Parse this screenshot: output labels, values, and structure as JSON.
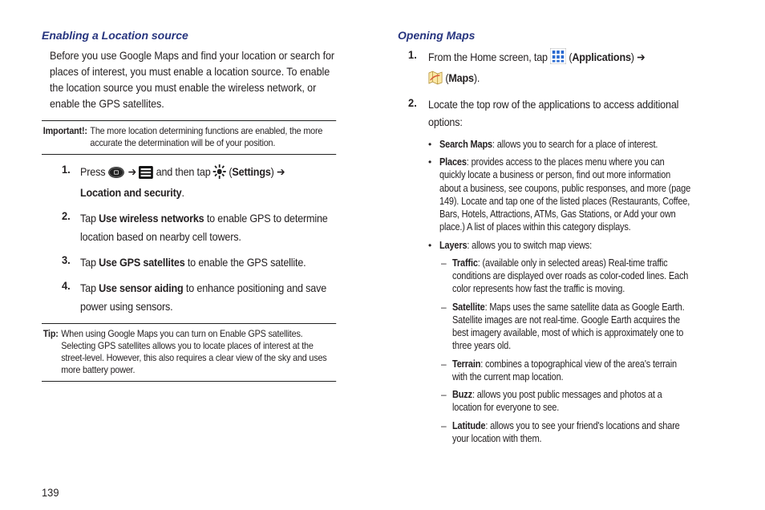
{
  "page_number": "139",
  "left": {
    "heading": "Enabling a Location source",
    "intro": "Before you use Google Maps and find your location or search for places of interest, you must enable a location source. To enable the location source you must enable the wireless network, or enable the GPS satellites.",
    "important_label": "Important!:",
    "important_text": "The more location determining functions are enabled, the more accurate the determination will be of your position.",
    "steps": [
      {
        "num": "1.",
        "pre": "Press ",
        "icon1_name": "home-button-icon",
        "arrow": " ➔ ",
        "icon2_name": "menu-icon",
        "mid": " and then tap ",
        "icon3_name": "settings-gear-icon",
        "open": " (",
        "label": "Settings",
        "close": ") ➔ ",
        "line2": "Location and security",
        "line2_end": "."
      },
      {
        "num": "2.",
        "pre": "Tap ",
        "bold": "Use wireless networks",
        "rest": " to enable GPS to determine location based on nearby cell towers."
      },
      {
        "num": "3.",
        "pre": "Tap ",
        "bold": "Use GPS satellites",
        "rest": " to enable the GPS satellite."
      },
      {
        "num": "4.",
        "pre": "Tap ",
        "bold": "Use sensor aiding",
        "rest": " to enhance positioning and save power using sensors."
      }
    ],
    "tip_label": "Tip:",
    "tip_text": "When using Google Maps you can turn on Enable GPS satellites. Selecting GPS satellites allows you to locate places of interest at the street-level. However, this also requires a clear view of the sky and uses more battery power."
  },
  "right": {
    "heading": "Opening Maps",
    "step1": {
      "num": "1.",
      "pre": "From the Home screen, tap ",
      "icon1_name": "apps-grid-icon",
      "open": " (",
      "apps_label": "Applications",
      "close_arrow": ") ➔ ",
      "icon2_name": "maps-icon",
      "open2": " (",
      "maps_label": "Maps",
      "close2": ")."
    },
    "step2": {
      "num": "2.",
      "text": "Locate the top row of the applications to access additional options:"
    },
    "bullets": [
      {
        "title": "Search Maps",
        "rest": ": allows you to search for a place of interest."
      },
      {
        "title": "Places",
        "rest": ": provides access to the places menu where you can quickly locate a business or person, find out more information about a business, see coupons, public responses, and more (page 149). Locate and tap one of the listed places (Restaurants, Coffee, Bars, Hotels, Attractions, ATMs, Gas Stations, or Add your own place.) A list of places within this category displays."
      },
      {
        "title": "Layers",
        "rest": ": allows you to switch map views:"
      }
    ],
    "sub": [
      {
        "title": "Traffic",
        "rest": ": (available only in selected areas) Real-time traffic conditions are displayed over roads as color-coded lines. Each color represents how fast the traffic is moving."
      },
      {
        "title": "Satellite",
        "rest": ": Maps uses the same satellite data as Google Earth. Satellite images are not real-time. Google Earth acquires the best imagery available, most of which is approximately one to three years old."
      },
      {
        "title": "Terrain",
        "rest": ": combines a topographical view of the area's terrain with the current map location."
      },
      {
        "title": "Buzz",
        "rest": ": allows you post public messages and photos at a location for everyone to see."
      },
      {
        "title": "Latitude",
        "rest": ": allows you to see your friend's locations and share your location with them."
      }
    ]
  }
}
